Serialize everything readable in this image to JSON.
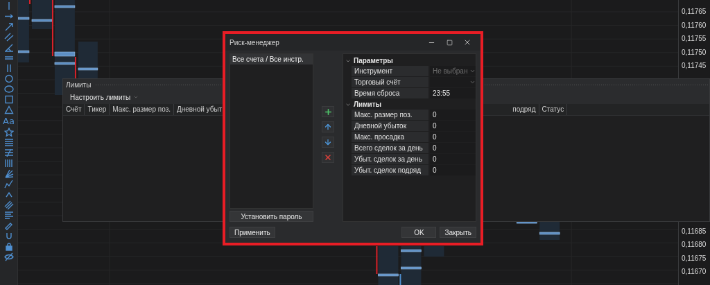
{
  "toolbar": {
    "text_tool": "Aa"
  },
  "price_axis": {
    "upper": [
      "0,11765",
      "0,11760",
      "0,11755",
      "0,11750",
      "0,11745"
    ],
    "lower": [
      "0,11685",
      "0,11680",
      "0,11675",
      "0,11670"
    ]
  },
  "limits_panel": {
    "title": "Лимиты",
    "menu_button": "Настроить лимиты",
    "columns_left": [
      "Счёт",
      "Тикер",
      "Макс. размер поз.",
      "Дневной убыт"
    ],
    "columns_right": [
      "подряд",
      "Статус"
    ]
  },
  "dialog": {
    "title": "Риск-менеджер",
    "list_items": [
      {
        "label": "Все счета / Все инстр.",
        "selected": true
      }
    ],
    "password_button": "Установить пароль",
    "sections": [
      {
        "title": "Параметры",
        "expanded": true,
        "rows": [
          {
            "label": "Инструмент",
            "kind": "dropdown",
            "placeholder": "Не выбран"
          },
          {
            "label": "Торговый счёт",
            "kind": "dropdown"
          },
          {
            "label": "Время сброса",
            "kind": "text",
            "value": "23:55"
          }
        ]
      },
      {
        "title": "Лимиты",
        "expanded": true,
        "rows": [
          {
            "label": "Макс. размер поз.",
            "kind": "text",
            "value": "0"
          },
          {
            "label": "Дневной убыток",
            "kind": "text",
            "value": "0"
          },
          {
            "label": "Макс. просадка",
            "kind": "text",
            "value": "0"
          },
          {
            "label": "Всего сделок за день",
            "kind": "text",
            "value": "0"
          },
          {
            "label": "Убыт. сделок за день",
            "kind": "text",
            "value": "0"
          },
          {
            "label": "Убыт. сделок подряд",
            "kind": "text",
            "value": "0"
          }
        ]
      }
    ],
    "apply_button": "Применить",
    "ok_button": "OK",
    "close_button": "Закрыть"
  }
}
